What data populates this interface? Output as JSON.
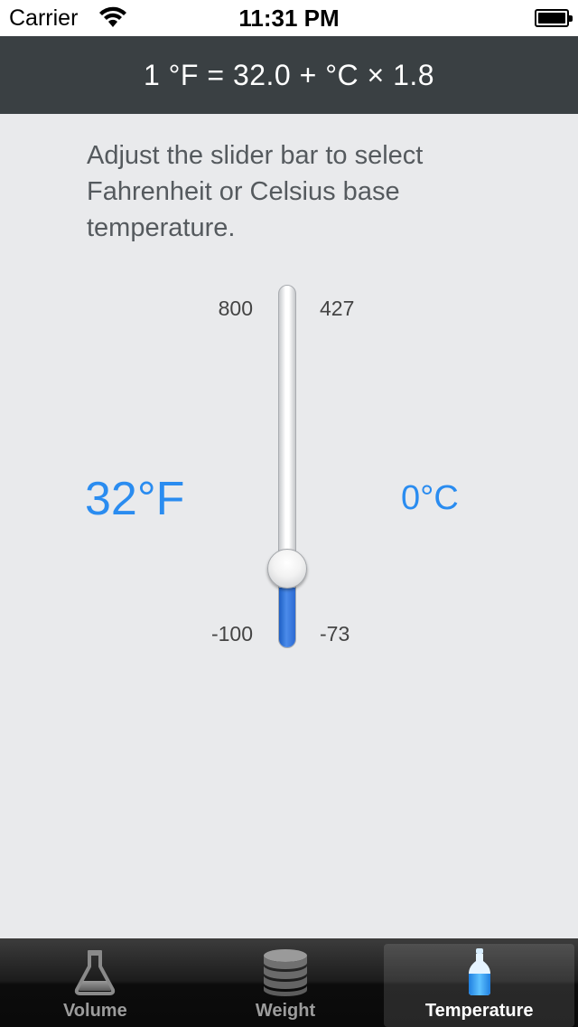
{
  "status_bar": {
    "carrier": "Carrier",
    "time": "11:31 PM"
  },
  "header": {
    "formula": "1 °F = 32.0 +  °C × 1.8"
  },
  "instructions": "Adjust the slider bar to select Fahrenheit or Celsius base temperature.",
  "slider": {
    "fahrenheit_max": "800",
    "celsius_max": "427",
    "fahrenheit_min": "-100",
    "celsius_min": "-73",
    "fahrenheit_value": 32,
    "fahrenheit_display": "32°F",
    "celsius_display": "0°C",
    "fill_color": "#2c6ad3"
  },
  "tabs": [
    {
      "label": "Volume",
      "icon": "flask-icon",
      "selected": false
    },
    {
      "label": "Weight",
      "icon": "weight-stack-icon",
      "selected": false
    },
    {
      "label": "Temperature",
      "icon": "thermometer-bottle-icon",
      "selected": true
    }
  ],
  "colors": {
    "accent": "#2a8cf0",
    "header_bg": "#3a4043",
    "background": "#e9eaec"
  }
}
